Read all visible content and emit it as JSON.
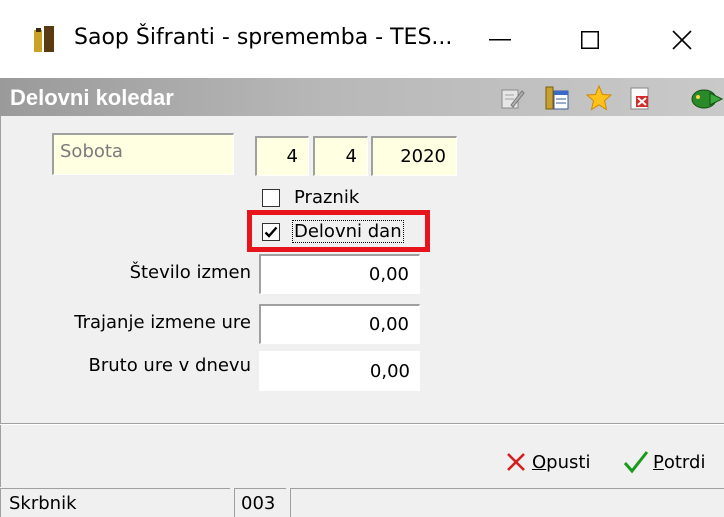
{
  "window": {
    "title": "Saop  Šifranti  - sprememba - TES...",
    "minimize_glyph": "—",
    "maximize_glyph": "☐",
    "close_glyph": "✕"
  },
  "header": {
    "title": "Delovni koledar",
    "toolbar_icons": [
      "edit-icon",
      "columns-icon",
      "star-icon",
      "excel-export-icon",
      "exit-icon"
    ]
  },
  "form": {
    "day_name": "Sobota",
    "day": "4",
    "month": "4",
    "year": "2020",
    "holiday": {
      "label": "Praznik",
      "checked": false
    },
    "working_day": {
      "label": "Delovni dan",
      "checked": true
    },
    "shift_count": {
      "label": "Število izmen",
      "value": "0,00"
    },
    "shift_duration": {
      "label": "Trajanje izmene ure",
      "value": "0,00"
    },
    "gross_hours": {
      "label": "Bruto ure v dnevu",
      "value": "0,00"
    }
  },
  "actions": {
    "cancel_prefix": "O",
    "cancel_rest": "pusti",
    "confirm_prefix": "P",
    "confirm_rest": "otrdi"
  },
  "status": {
    "user": "Skrbnik",
    "code": "003",
    "extra": ""
  },
  "colors": {
    "highlight_border": "#e8141c",
    "field_yellow": "#ffffe1",
    "cancel_red": "#d32020",
    "confirm_green": "#1a9a1a"
  }
}
